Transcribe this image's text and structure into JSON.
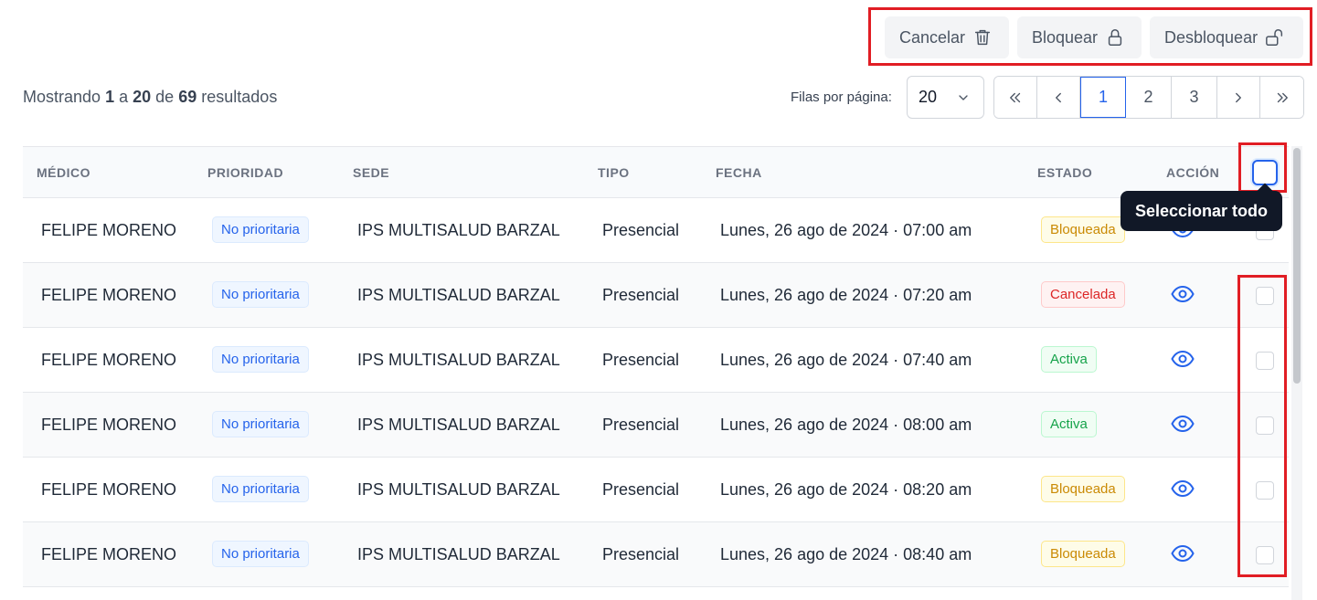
{
  "toolbar": {
    "cancel_label": "Cancelar",
    "block_label": "Bloquear",
    "unblock_label": "Desbloquear",
    "icons": {
      "cancel": "trash-icon",
      "block": "lock-icon",
      "unblock": "unlock-icon"
    }
  },
  "summary": {
    "prefix": "Mostrando",
    "from": "1",
    "a": "a",
    "to": "20",
    "de": "de",
    "total": "69",
    "suffix": "resultados"
  },
  "pagination": {
    "rows_label": "Filas por página:",
    "rows_value": "20",
    "pages": [
      "1",
      "2",
      "3"
    ],
    "current_page": "1"
  },
  "table": {
    "headers": {
      "medico": "MÉDICO",
      "prioridad": "PRIORIDAD",
      "sede": "SEDE",
      "tipo": "TIPO",
      "fecha": "FECHA",
      "estado": "ESTADO",
      "accion": "ACCIÓN"
    },
    "rows": [
      {
        "medico": "FELIPE MORENO",
        "prioridad": "No prioritaria",
        "sede": "IPS MULTISALUD BARZAL",
        "tipo": "Presencial",
        "fecha": "Lunes, 26 ago de 2024 · 07:00 am",
        "estado": "Bloqueada"
      },
      {
        "medico": "FELIPE MORENO",
        "prioridad": "No prioritaria",
        "sede": "IPS MULTISALUD BARZAL",
        "tipo": "Presencial",
        "fecha": "Lunes, 26 ago de 2024 · 07:20 am",
        "estado": "Cancelada"
      },
      {
        "medico": "FELIPE MORENO",
        "prioridad": "No prioritaria",
        "sede": "IPS MULTISALUD BARZAL",
        "tipo": "Presencial",
        "fecha": "Lunes, 26 ago de 2024 · 07:40 am",
        "estado": "Activa"
      },
      {
        "medico": "FELIPE MORENO",
        "prioridad": "No prioritaria",
        "sede": "IPS MULTISALUD BARZAL",
        "tipo": "Presencial",
        "fecha": "Lunes, 26 ago de 2024 · 08:00 am",
        "estado": "Activa"
      },
      {
        "medico": "FELIPE MORENO",
        "prioridad": "No prioritaria",
        "sede": "IPS MULTISALUD BARZAL",
        "tipo": "Presencial",
        "fecha": "Lunes, 26 ago de 2024 · 08:20 am",
        "estado": "Bloqueada"
      },
      {
        "medico": "FELIPE MORENO",
        "prioridad": "No prioritaria",
        "sede": "IPS MULTISALUD BARZAL",
        "tipo": "Presencial",
        "fecha": "Lunes, 26 ago de 2024 · 08:40 am",
        "estado": "Bloqueada"
      }
    ]
  },
  "tooltip": {
    "select_all": "Seleccionar todo"
  },
  "colors": {
    "accent": "#2563eb",
    "highlight_border": "#e11d24",
    "bloqueada": "#ca8a04",
    "cancelada": "#dc2626",
    "activa": "#16a34a"
  }
}
